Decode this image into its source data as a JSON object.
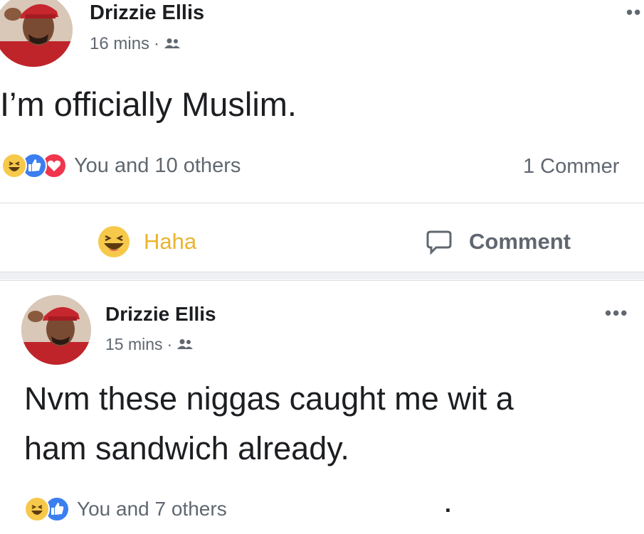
{
  "posts": [
    {
      "author": "Drizzie Ellis",
      "time": "16 mins",
      "separator": "·",
      "audience_icon": "friends-icon",
      "text": "I’m officially Muslim.",
      "reactions": [
        "haha",
        "like",
        "love"
      ],
      "reaction_summary": "You and 10 others",
      "comment_count": "1 Commer",
      "actions": {
        "haha_label": "Haha",
        "comment_label": "Comment"
      }
    },
    {
      "author": "Drizzie Ellis",
      "time": "15 mins",
      "separator": "·",
      "audience_icon": "friends-icon",
      "text_lines": [
        "Nvm these niggas caught me wit a",
        "ham sandwich already."
      ],
      "reactions": [
        "haha",
        "like"
      ],
      "reaction_summary": "You and 7 others",
      "trailing_mark": "."
    }
  ],
  "colors": {
    "haha": "#f7c94b",
    "like": "#3b7ef0",
    "love": "#f0364d",
    "haha_label": "#e9b42e",
    "secondary_text": "#606770",
    "primary_text": "#1c1e21"
  }
}
